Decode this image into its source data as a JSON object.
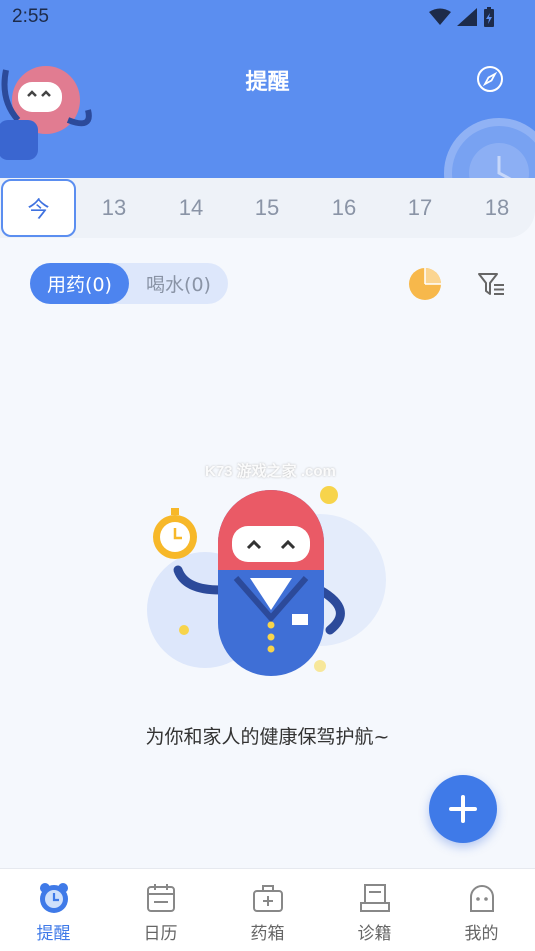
{
  "status_bar": {
    "time": "2:55"
  },
  "header": {
    "title": "提醒",
    "compass_icon": "compass-icon"
  },
  "date_strip": {
    "items": [
      {
        "label": "今",
        "selected": true
      },
      {
        "label": "13"
      },
      {
        "label": "14"
      },
      {
        "label": "15"
      },
      {
        "label": "16"
      },
      {
        "label": "17"
      },
      {
        "label": "18"
      }
    ]
  },
  "toggle": {
    "active_label": "用药(0)",
    "inactive_label": "喝水(0)"
  },
  "tools": {
    "pie_icon": "pie-chart-icon",
    "filter_icon": "filter-list-icon"
  },
  "empty_state": {
    "message": "为你和家人的健康保驾护航~",
    "watermark": "K73 游戏之家 .com"
  },
  "fab": {
    "icon": "plus-icon"
  },
  "bottom_nav": {
    "items": [
      {
        "label": "提醒",
        "icon": "alarm-clock-icon",
        "active": true
      },
      {
        "label": "日历",
        "icon": "calendar-icon"
      },
      {
        "label": "药箱",
        "icon": "medicine-box-icon"
      },
      {
        "label": "诊籍",
        "icon": "record-book-icon"
      },
      {
        "label": "我的",
        "icon": "profile-icon"
      }
    ]
  },
  "colors": {
    "primary": "#5b8ef0",
    "accent": "#3f7ae8",
    "pie": "#f7b84b"
  }
}
